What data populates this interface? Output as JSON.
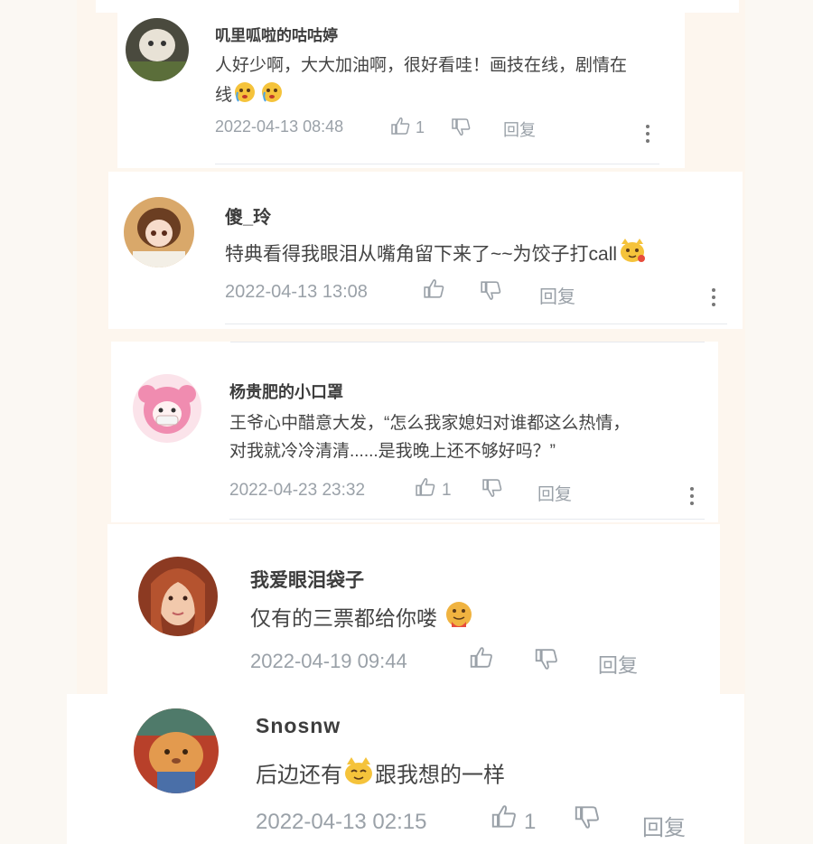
{
  "comments": [
    {
      "name": "叽里呱啦的咕咕婷",
      "text_line1": "人好少啊，大大加油啊，很好看哇！画技在线，剧情在",
      "text_line2": "线",
      "emojis_line2": [
        "crying-face-emoji",
        "crying-face-emoji"
      ],
      "date": "2022-04-13 08:48",
      "likes": "1",
      "reply": "回复"
    },
    {
      "name": "傻_玲",
      "text_line1": "特典看得我眼泪从嘴角留下来了~~为饺子打call",
      "emojis_line1": [
        "cat-emoji"
      ],
      "date": "2022-04-13 13:08",
      "likes": "",
      "reply": "回复"
    },
    {
      "name": "杨贵肥的小口罩",
      "text_line1": "王爷心中醋意大发，“怎么我家媳妇对谁都这么热情，",
      "text_line2": "对我就冷冷清清......是我晚上还不够好吗？”",
      "date": "2022-04-23 23:32",
      "likes": "1",
      "reply": "回复"
    },
    {
      "name": "我爱眼泪袋子",
      "text_line1": "仅有的三票都给你喽",
      "emojis_line1": [
        "hug-face-emoji"
      ],
      "date": "2022-04-19 09:44",
      "likes": "",
      "reply": "回复"
    },
    {
      "name": "Snosnw",
      "text_before": "后边还有",
      "emojis_middle": [
        "cat-emoji"
      ],
      "text_after": "跟我想的一样",
      "date": "2022-04-13 02:15",
      "likes": "1",
      "reply": "回复"
    }
  ],
  "icons": {
    "like": "thumbs-up-icon",
    "dislike": "thumbs-down-icon",
    "more": "more-vertical-icon"
  },
  "colors": {
    "background": "#fbf8f3",
    "card": "#ffffff",
    "name": "#3d3d3d",
    "text": "#444444",
    "meta": "#9aa1a8"
  }
}
